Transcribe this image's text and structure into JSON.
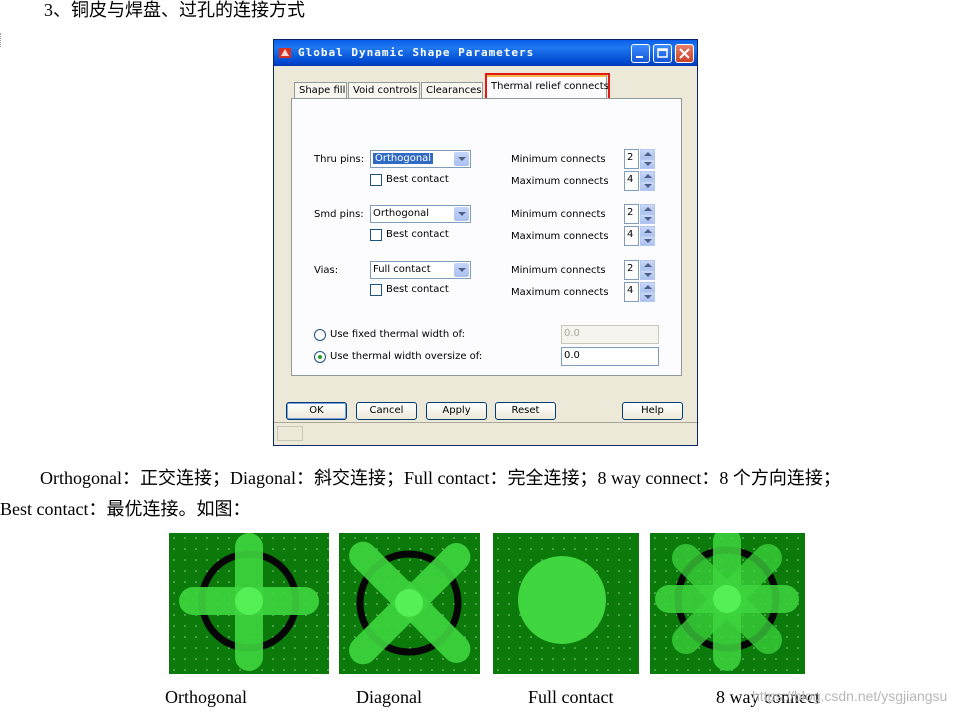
{
  "doc": {
    "heading": "3、铜皮与焊盘、过孔的连接方式",
    "paragraph_line1": "Orthogonal：正交连接；Diagonal：斜交连接；Full  contact：完全连接；8  way  connect：8 个方向连接；",
    "paragraph_line2": "Best  contact：最优连接。如图：",
    "captions": [
      "Orthogonal",
      "Diagonal",
      "Full  contact",
      "8  way  connect"
    ],
    "watermark": "https://blog.csdn.net/ysgjiangsu"
  },
  "dialog": {
    "title": "Global Dynamic Shape Parameters",
    "tabs": [
      "Shape fill",
      "Void controls",
      "Clearances",
      "Thermal relief connects"
    ],
    "active_tab": "Thermal relief connects",
    "highlight_color": "#e01818",
    "rows": [
      {
        "label": "Thru pins:",
        "value": "Orthogonal",
        "best_contact": "Best contact",
        "min_label": "Minimum connects",
        "min": "2",
        "max_label": "Maximum connects",
        "max": "4"
      },
      {
        "label": "Smd pins:",
        "value": "Orthogonal",
        "best_contact": "Best contact",
        "min_label": "Minimum connects",
        "min": "2",
        "max_label": "Maximum connects",
        "max": "4"
      },
      {
        "label": "Vias:",
        "value": "Full contact",
        "best_contact": "Best contact",
        "min_label": "Minimum connects",
        "min": "2",
        "max_label": "Maximum connects",
        "max": "4"
      }
    ],
    "fixed_width_label": "Use fixed thermal width of:",
    "fixed_width_value": "0.0",
    "oversize_label": "Use thermal width oversize of:",
    "oversize_value": "0.0",
    "selected_radio": "oversize",
    "buttons": {
      "ok": "OK",
      "cancel": "Cancel",
      "apply": "Apply",
      "reset": "Reset",
      "help": "Help"
    }
  },
  "colors": {
    "pad_background": "#0b7a0b",
    "thermal_spoke": "#3ed63e",
    "full_contact": "#3fd63f",
    "antipad_ring": "#060606"
  }
}
